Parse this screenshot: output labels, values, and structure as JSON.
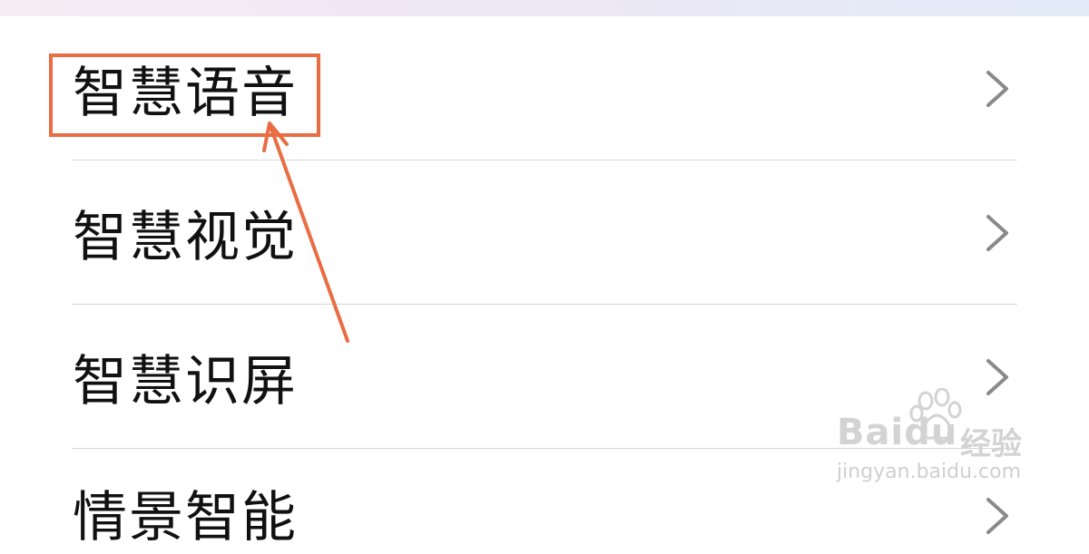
{
  "settings_list": {
    "items": [
      {
        "label": "智慧语音",
        "icon": "chevron-right-icon"
      },
      {
        "label": "智慧视觉",
        "icon": "chevron-right-icon"
      },
      {
        "label": "智慧识屏",
        "icon": "chevron-right-icon"
      },
      {
        "label": "情景智能",
        "icon": "chevron-right-icon"
      }
    ]
  },
  "annotation": {
    "highlight_color": "#ea6c42",
    "target": "智慧语音"
  },
  "watermark": {
    "brand": "Baidu",
    "brand_cn": "经验",
    "url": "jingyan.baidu.com",
    "icon": "paw-icon"
  },
  "colors": {
    "text": "#111111",
    "chevron": "#8a8a8a",
    "divider": "#d6d6d6",
    "top_strip_start": "#f6ecf3",
    "top_strip_end": "#e2ebf8"
  }
}
